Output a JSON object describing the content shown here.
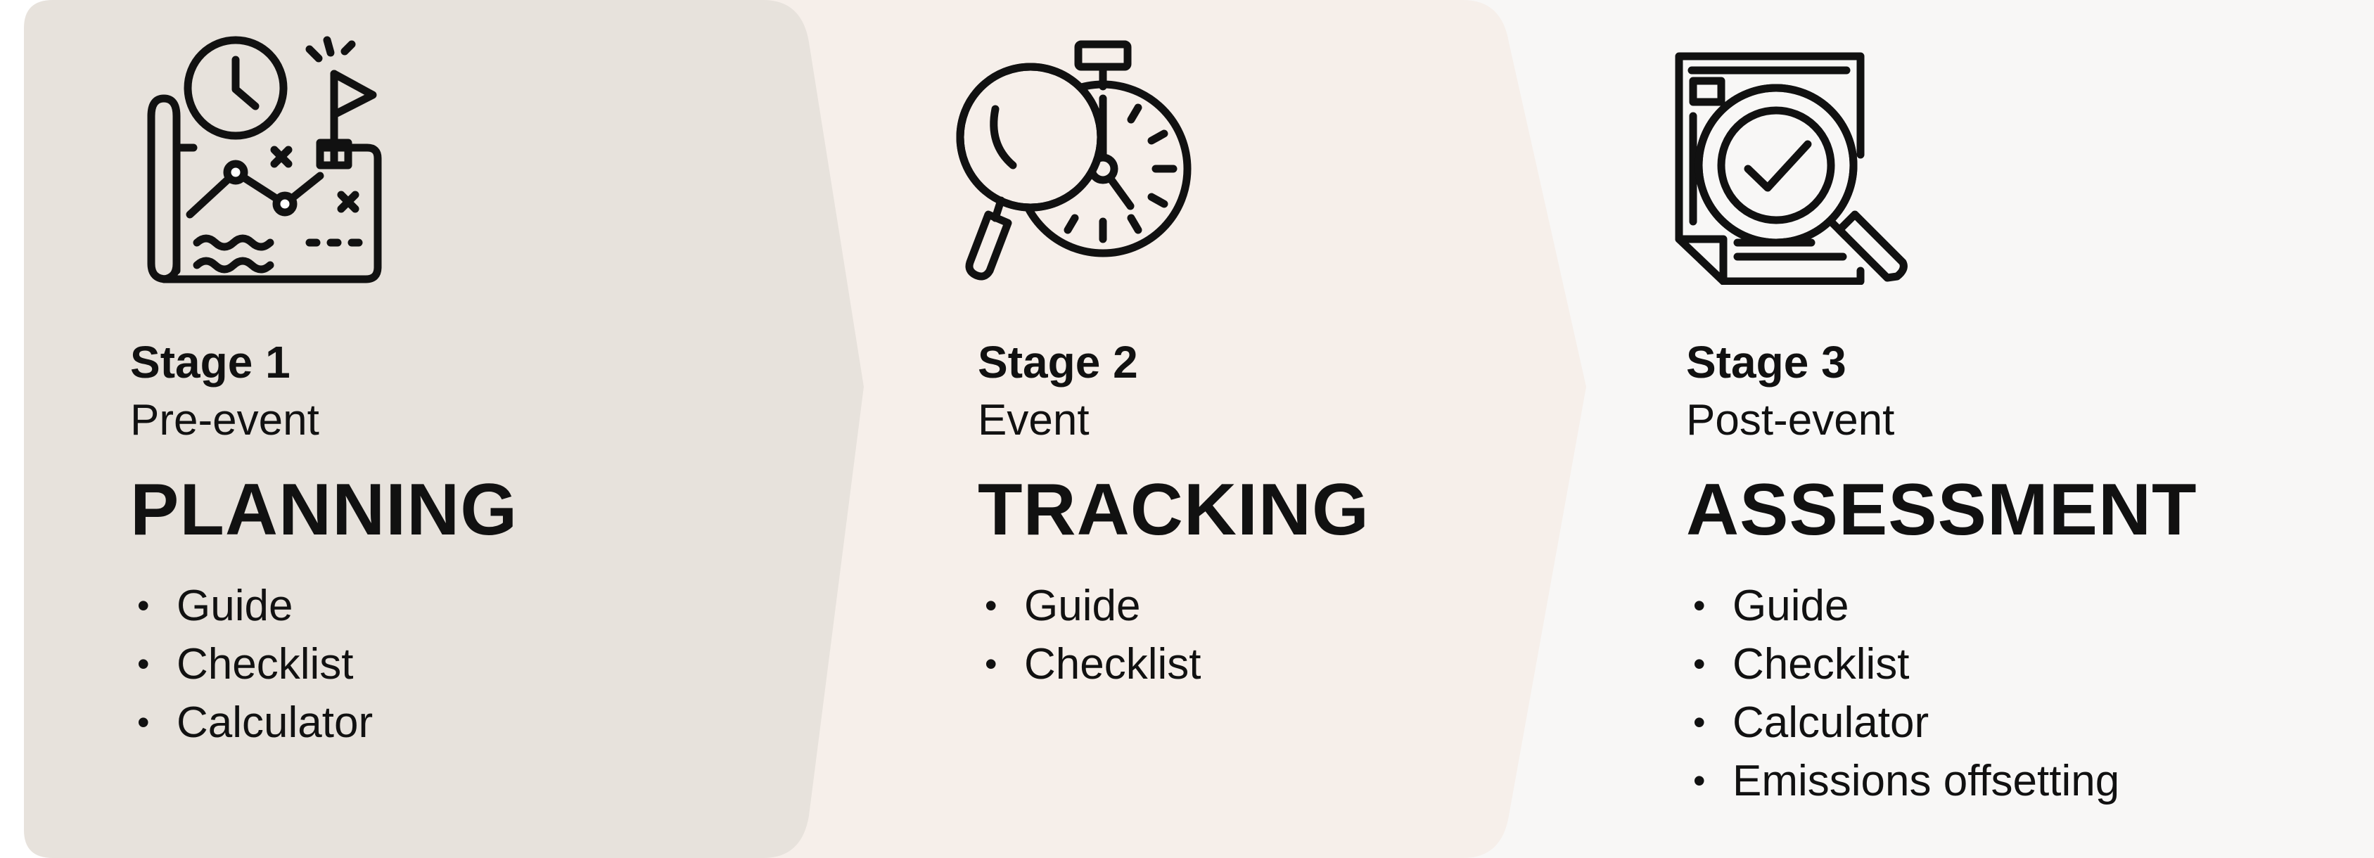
{
  "colors": {
    "stage1_bg": "#E7E2DC",
    "stage2_bg": "#F6EFEA",
    "stage3_bg": "#F8F7F6",
    "text": "#111111",
    "icon_stroke": "#111111"
  },
  "stages": [
    {
      "icon": "planning-map-icon",
      "number": "Stage 1",
      "phase": "Pre-event",
      "title": "PLANNING",
      "items": [
        "Guide",
        "Checklist",
        "Calculator"
      ]
    },
    {
      "icon": "stopwatch-magnifier-icon",
      "number": "Stage 2",
      "phase": "Event",
      "title": "TRACKING",
      "items": [
        "Guide",
        "Checklist"
      ]
    },
    {
      "icon": "document-check-icon",
      "number": "Stage 3",
      "phase": "Post-event",
      "title": "ASSESSMENT",
      "items": [
        "Guide",
        "Checklist",
        "Calculator",
        "Emissions offsetting"
      ]
    }
  ]
}
